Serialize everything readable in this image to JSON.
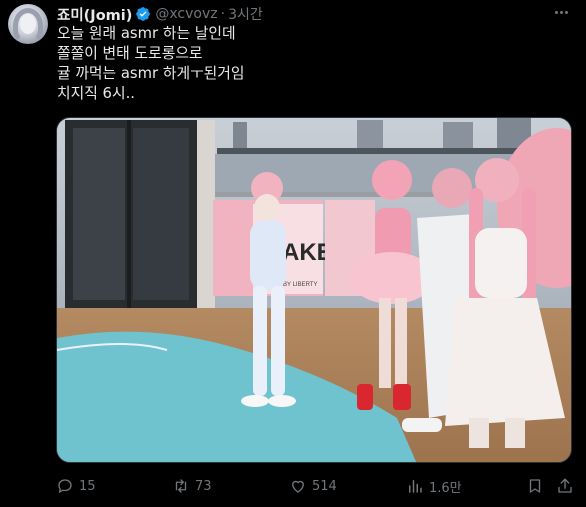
{
  "tweet": {
    "author_name": "죠미(Jomi)",
    "handle": "@xcvovz",
    "separator": "·",
    "time": "3시간",
    "lines": [
      "오늘 원래 asmr 하는 날인데",
      "쫄쫄이 변태 도로롱으로",
      "귤 까먹는 asmr 하게ㅜ된거임",
      "치지직 6시.."
    ]
  },
  "media": {
    "banner_text": "AKE",
    "banner_subtext": "BY LIBERTY"
  },
  "actions": {
    "replies": "15",
    "reposts": "73",
    "likes": "514",
    "views": "1.6만"
  },
  "colors": {
    "background": "#000000",
    "text": "#e7e9ea",
    "muted": "#71767b",
    "verified": "#1d9bf0"
  }
}
